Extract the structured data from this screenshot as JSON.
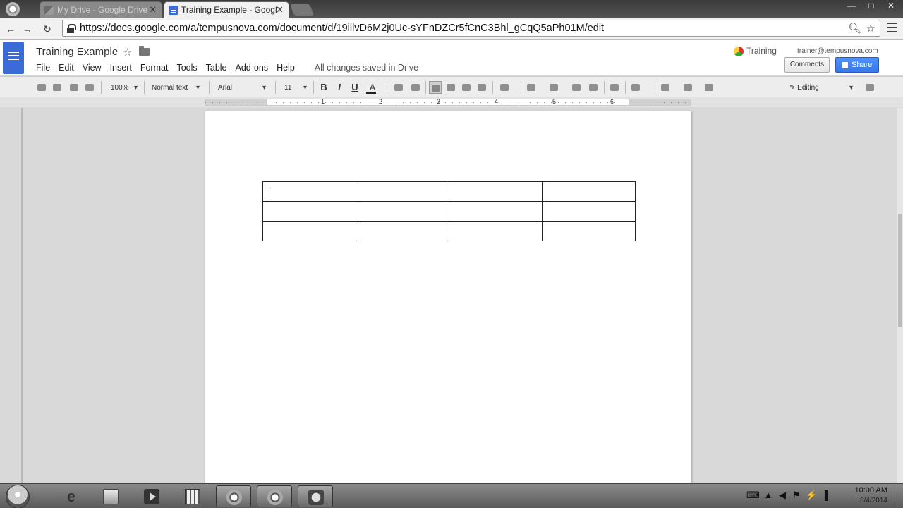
{
  "browser": {
    "tabs": [
      {
        "label": "My Drive - Google Drive",
        "active": false
      },
      {
        "label": "Training Example - Googl",
        "active": true
      }
    ],
    "url": "https://docs.google.com/a/tempusnova.com/document/d/19illvD6M2j0Uc-sYFnDZCr5fCnC3Bhl_gCqQ5aPh01M/edit",
    "controls": {
      "minimize": "—",
      "maximize": "□",
      "close": "✕"
    }
  },
  "docs": {
    "title": "Training Example",
    "star_glyph": "☆",
    "menu": [
      "File",
      "Edit",
      "View",
      "Insert",
      "Format",
      "Tools",
      "Table",
      "Add-ons",
      "Help"
    ],
    "save_status": "All changes saved in Drive",
    "account_name": "Training",
    "account_email": "trainer@tempusnova.com",
    "comments_label": "Comments",
    "share_label": "Share"
  },
  "toolbar": {
    "zoom": "100%",
    "style": "Normal text",
    "font": "Arial",
    "size": "11",
    "bold": "B",
    "italic": "I",
    "underline": "U",
    "text_color": "A",
    "mode": "Editing"
  },
  "ruler": {
    "numbers": [
      "1",
      "2",
      "3",
      "4",
      "5",
      "6"
    ]
  },
  "document": {
    "table": {
      "rows": 3,
      "cols": 4,
      "cells": [
        [
          "",
          "",
          "",
          ""
        ],
        [
          "",
          "",
          "",
          ""
        ],
        [
          "",
          "",
          "",
          ""
        ]
      ]
    }
  },
  "taskbar": {
    "apps": [
      "Internet Explorer",
      "Windows Explorer",
      "Media Player",
      "Calculator",
      "Google Chrome",
      "Google Chrome",
      "Application"
    ],
    "time": "10:00 AM",
    "date": "8/4/2014"
  },
  "colors": {
    "docs_blue": "#3b6bd6",
    "share_blue": "#4d90fe"
  }
}
